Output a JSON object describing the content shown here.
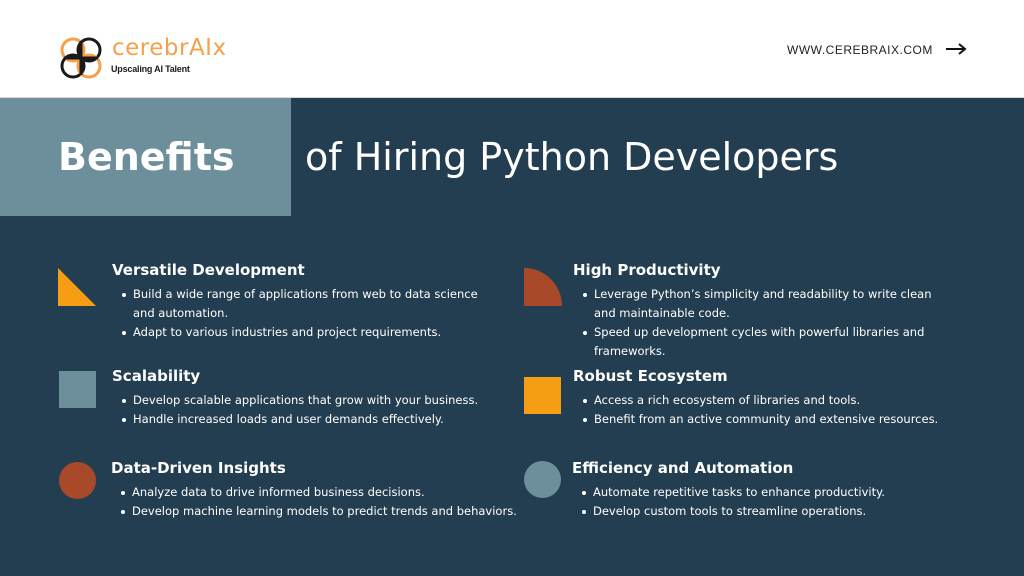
{
  "brand": {
    "name": "cerebrAIx",
    "tagline": "Upscaling AI Talent",
    "url": "WWW.CEREBRAIX.COM",
    "accent": "#f5a04a"
  },
  "title": {
    "emphasis": "Benefits",
    "rest": "of Hiring Python Developers"
  },
  "colors": {
    "panel": "#233e50",
    "title_box": "#6c8f9b",
    "orange": "#f59d13",
    "rust": "#a8492a",
    "slate": "#6c8f9b"
  },
  "features": [
    {
      "title": "Versatile Development",
      "icon": "triangle-icon",
      "bullets": [
        "Build a wide range of applications from web to data science and automation.",
        "Adapt to various industries and project requirements."
      ]
    },
    {
      "title": "High Productivity",
      "icon": "quarter-circle-icon",
      "bullets": [
        "Leverage Python’s simplicity and readability to write clean and maintainable code.",
        "Speed up development cycles with powerful libraries and frameworks."
      ]
    },
    {
      "title": "Scalability",
      "icon": "square-icon",
      "bullets": [
        "Develop scalable applications that grow with your business.",
        "Handle increased loads and user demands effectively."
      ]
    },
    {
      "title": "Robust Ecosystem",
      "icon": "square-icon",
      "bullets": [
        "Access a rich ecosystem of libraries and tools.",
        "Benefit from an active community and extensive resources."
      ]
    },
    {
      "title": "Data-Driven Insights",
      "icon": "circle-icon",
      "bullets": [
        "Analyze data to drive informed business decisions.",
        "Develop machine learning models to predict trends and behaviors."
      ]
    },
    {
      "title": "Efficiency and Automation",
      "icon": "circle-icon",
      "bullets": [
        "Automate repetitive tasks to enhance productivity.",
        "Develop custom tools to streamline operations."
      ]
    }
  ]
}
